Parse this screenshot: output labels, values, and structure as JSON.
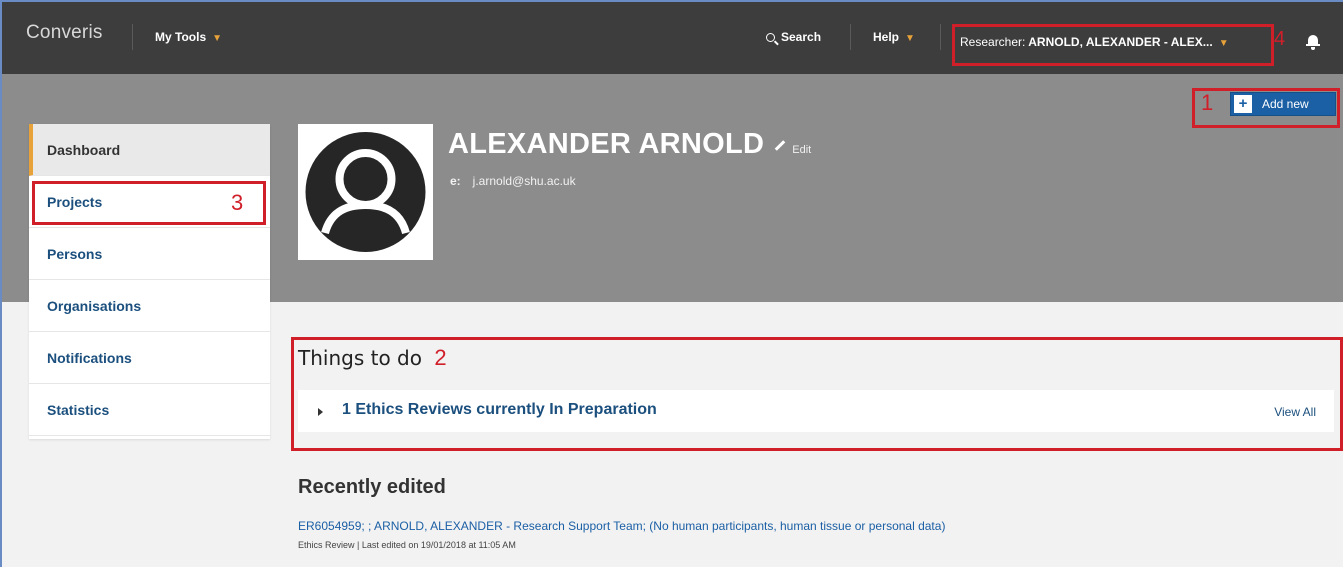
{
  "header": {
    "logo": "Converis",
    "my_tools": "My Tools",
    "search": "Search",
    "help": "Help",
    "researcher_prefix": "Researcher:",
    "researcher_name": "ARNOLD, ALEXANDER - ALEX...",
    "notification_icon": "bell-icon"
  },
  "annotations": {
    "n1": "1",
    "n2": "2",
    "n3": "3",
    "n4": "4",
    "color": "#d11f2a"
  },
  "actions": {
    "add_new": "Add new"
  },
  "sidebar": {
    "items": [
      {
        "label": "Dashboard",
        "active": true
      },
      {
        "label": "Projects"
      },
      {
        "label": "Persons"
      },
      {
        "label": "Organisations"
      },
      {
        "label": "Notifications"
      },
      {
        "label": "Statistics"
      }
    ]
  },
  "profile": {
    "name": "ALEXANDER ARNOLD",
    "edit": "Edit",
    "email_label": "e:",
    "email": "j.arnold@shu.ac.uk"
  },
  "todo": {
    "title": "Things to do",
    "item": "1 Ethics Reviews currently In Preparation",
    "view_all": "View All"
  },
  "recent": {
    "title": "Recently edited",
    "item_link": "ER6054959; ; ARNOLD, ALEXANDER - Research Support Team; (No human participants, human tissue or personal data)",
    "item_meta": "Ethics Review | Last edited on 19/01/2018 at 11:05 AM"
  },
  "colors": {
    "topbar": "#3d3d3d",
    "banner": "#8c8c8c",
    "accent": "#e8a23a",
    "link": "#1b4f7e",
    "button": "#1b5fa5"
  }
}
